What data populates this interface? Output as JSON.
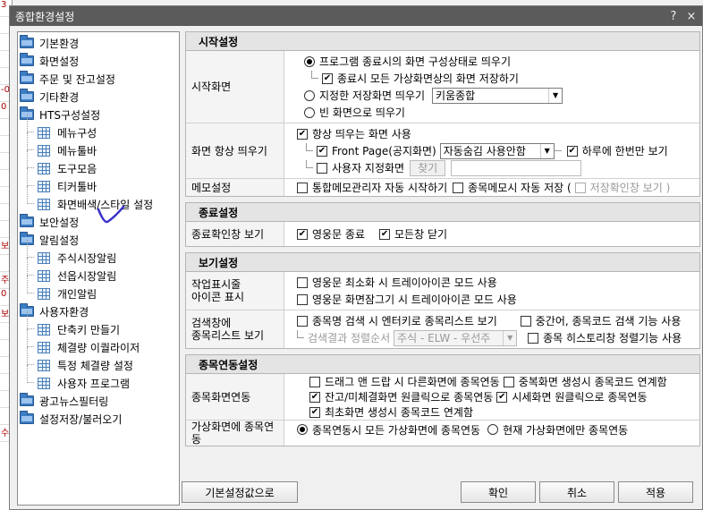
{
  "window": {
    "title": "종합환경설정",
    "help_glyph": "?",
    "close_glyph": "×"
  },
  "background_strip": [
    "3",
    "",
    "",
    "",
    "",
    "-0",
    "0",
    "",
    "",
    "",
    "",
    "",
    "",
    "",
    "보",
    "",
    "주",
    "0",
    "보",
    "",
    "",
    "",
    "",
    "",
    "",
    "수"
  ],
  "tree": {
    "items": [
      {
        "label": "기본환경",
        "level": 0,
        "icon": "folder-icon"
      },
      {
        "label": "화면설정",
        "level": 0,
        "icon": "folder-icon"
      },
      {
        "label": "주문 및 잔고설정",
        "level": 0,
        "icon": "folder-icon"
      },
      {
        "label": "기타환경",
        "level": 0,
        "icon": "folder-icon"
      },
      {
        "label": "HTS구성설정",
        "level": 0,
        "icon": "folder-icon"
      },
      {
        "label": "메뉴구성",
        "level": 1,
        "icon": "grid-icon"
      },
      {
        "label": "메뉴툴바",
        "level": 1,
        "icon": "grid-icon"
      },
      {
        "label": "도구모음",
        "level": 1,
        "icon": "grid-icon"
      },
      {
        "label": "티커툴바",
        "level": 1,
        "icon": "grid-icon"
      },
      {
        "label": "화면배색/스타일 설정",
        "level": 1,
        "icon": "grid-icon"
      },
      {
        "label": "보안설정",
        "level": 0,
        "icon": "folder-icon"
      },
      {
        "label": "알림설정",
        "level": 0,
        "icon": "folder-icon"
      },
      {
        "label": "주식시장알림",
        "level": 1,
        "icon": "grid-icon"
      },
      {
        "label": "선옵시장알림",
        "level": 1,
        "icon": "grid-icon"
      },
      {
        "label": "개인알림",
        "level": 1,
        "icon": "grid-icon"
      },
      {
        "label": "사용자환경",
        "level": 0,
        "icon": "folder-icon"
      },
      {
        "label": "단축키 만들기",
        "level": 1,
        "icon": "grid-icon"
      },
      {
        "label": "체결량 이퀄라이저",
        "level": 1,
        "icon": "grid-icon"
      },
      {
        "label": "특정 체결량 설정",
        "level": 1,
        "icon": "grid-icon"
      },
      {
        "label": "사용자 프로그램",
        "level": 1,
        "icon": "grid-icon"
      },
      {
        "label": "광고뉴스필터링",
        "level": 0,
        "icon": "folder-icon"
      },
      {
        "label": "설정저장/불러오기",
        "level": 0,
        "icon": "folder-icon"
      }
    ]
  },
  "sections": {
    "start": {
      "title": "시작설정",
      "screen_label": "시작화면",
      "opt_keep_last": "프로그램 종료시의 화면 구성상태로 띄우기",
      "opt_keep_last_checked": true,
      "save_all_virtual": "종료시 모든 가상화면상의 화면 저장하기",
      "save_all_virtual_checked": true,
      "opt_saved_screen": "지정한 저장화면 띄우기",
      "saved_screen_select": "키움종합",
      "opt_blank": "빈 화면으로 띄우기",
      "always_label": "화면 항상 띄우기",
      "always_use": "항상 띄우는 화면 사용",
      "always_use_checked": true,
      "front_page": "Front Page(공지화면)",
      "front_page_checked": true,
      "front_page_select": "자동숨김 사용안함",
      "once_a_day": "하루에 한번만 보기",
      "once_a_day_checked": true,
      "user_screen": "사용자 지정화면",
      "user_screen_checked": false,
      "find_button": "찾기",
      "memo_label": "메모설정",
      "memo_auto": "통합메모관리자 자동 시작하기",
      "memo_auto_checked": false,
      "stock_memo": "종목메모시 자동 저장 (",
      "stock_memo_checked": false,
      "save_confirm": "저장확인창 보기 )",
      "save_confirm_checked": false
    },
    "exit": {
      "title": "종료설정",
      "confirm_label": "종료확인창 보기",
      "yg_exit": "영웅문 종료",
      "yg_exit_checked": true,
      "close_all": "모든창 닫기",
      "close_all_checked": true
    },
    "view": {
      "title": "보기설정",
      "tray_label_1": "작업표시줄",
      "tray_label_2": "아이콘 표시",
      "tray_min": "영웅문 최소화 시 트레이아이콘 모드 사용",
      "tray_min_checked": false,
      "tray_hide": "영웅문 화면잠그기 시 트레이아이콘 모드 사용",
      "tray_hide_checked": false,
      "search_label_1": "검색창에",
      "search_label_2": "종목리스트 보기",
      "search_enter": "종목명 검색 시 엔터키로 종목리스트 보기",
      "search_enter_checked": false,
      "middle_search": "중간어, 종목코드 검색 기능 사용",
      "middle_search_checked": false,
      "sort_label": "검색결과 정렬순서",
      "sort_select": "주식 - ELW - 우선주",
      "history_sort": "종목 히스토리창 정렬기능 사용",
      "history_sort_checked": false
    },
    "link": {
      "title": "종목연동설정",
      "link_label": "종목화면연동",
      "drag_drop": "드래그 앤 드랍 시 다른화면에 종목연동",
      "drag_drop_checked": false,
      "dup_screen": "중복화면 생성시 종목코드 연계함",
      "dup_screen_checked": false,
      "balance_click": "잔고/미체결화면 원클릭으로 종목연동",
      "balance_click_checked": true,
      "quote_click": "시세화면 원클릭으로 종목연동",
      "quote_click_checked": true,
      "first_screen": "최초화면 생성시 종목코드 연계함",
      "first_screen_checked": true,
      "virtual_label": "가상화면에 종목연동",
      "all_virtual": "종목연동시 모든 가상화면에 종목연동",
      "all_virtual_selected": true,
      "current_virtual": "현재 가상화면에만 종목연동",
      "current_virtual_selected": false
    }
  },
  "buttons": {
    "defaults": "기본설정값으로",
    "ok": "확인",
    "cancel": "취소",
    "apply": "적용"
  }
}
